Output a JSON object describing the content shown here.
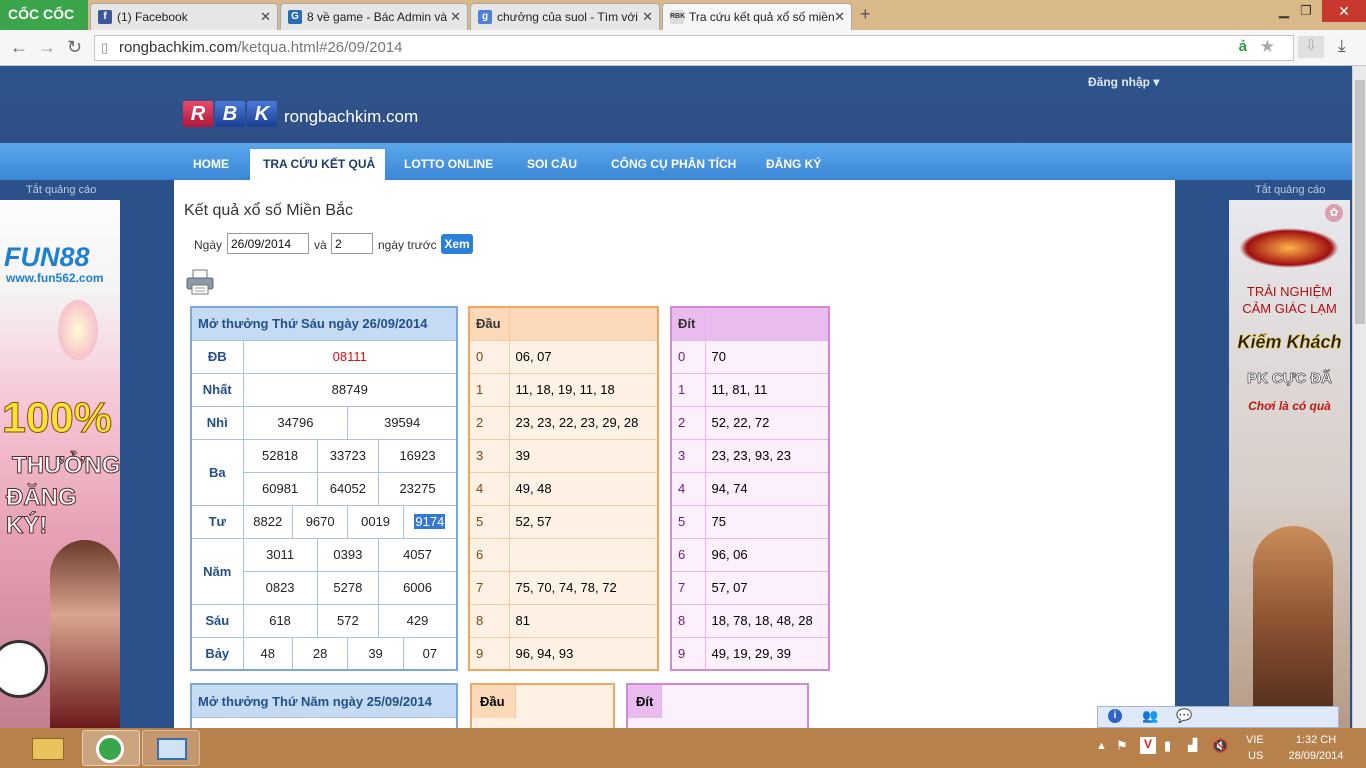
{
  "browser": {
    "app_name": "CỐC CỐC",
    "tabs": [
      {
        "label": "(1) Facebook",
        "icon": "facebook-icon"
      },
      {
        "label": "8 về game - Bác Admin và",
        "icon": "game-site-icon"
      },
      {
        "label": "chưởng của suol - Tìm với",
        "icon": "google-icon"
      },
      {
        "label": "Tra cứu kết quả xổ số miền",
        "icon": "rbk-icon"
      }
    ],
    "url_host": "rongbachkim.com",
    "url_path": "/ketqua.html#26/09/2014"
  },
  "site": {
    "login": "Đăng nhập ▾",
    "logo_letters": [
      "R",
      "B",
      "K"
    ],
    "name": "rongbachkim.com",
    "menu": [
      "HOME",
      "TRA CỨU KẾT QUẢ",
      "LOTTO ONLINE",
      "SOI CẦU",
      "CÔNG CỤ PHÂN TÍCH",
      "ĐĂNG KÝ"
    ],
    "active_menu_index": 1,
    "ad_close_label": "Tắt quảng cáo"
  },
  "left_ad": {
    "brand": "FUN88",
    "url": "www.fun562.com",
    "headline": "100%",
    "line1": "THƯỞNG",
    "line2": "ĐĂNG KÝ!"
  },
  "right_ad": {
    "line1": "TRẢI NGHIỆM",
    "line2": "CẢM GIÁC LẠM",
    "line3": "Kiếm Khách",
    "line4": "PK CỰC ĐÃ",
    "line5": "Chơi là có quà"
  },
  "page": {
    "title": "Kết quả xổ số Miền Bắc",
    "date_label": "Ngày",
    "date_value": "26/09/2014",
    "and_label": "và",
    "days_value": "2",
    "days_before_label": "ngày trước",
    "view_button": "Xem"
  },
  "results": {
    "title": "Mở thưởng Thứ Sáu ngày 26/09/2014",
    "db_label": "ĐB",
    "db": "08111",
    "nhat_label": "Nhất",
    "nhat": "88749",
    "nhi_label": "Nhì",
    "nhi": [
      "34796",
      "39594"
    ],
    "ba_label": "Ba",
    "ba": [
      [
        "52818",
        "33723",
        "16923"
      ],
      [
        "60981",
        "64052",
        "23275"
      ]
    ],
    "tu_label": "Tư",
    "tu": [
      "8822",
      "9670",
      "0019",
      "9174"
    ],
    "nam_label": "Năm",
    "nam": [
      [
        "3011",
        "0393",
        "4057"
      ],
      [
        "0823",
        "5278",
        "6006"
      ]
    ],
    "sau_label": "Sáu",
    "sau": [
      "618",
      "572",
      "429"
    ],
    "bay_label": "Bảy",
    "bay": [
      "48",
      "28",
      "39",
      "07"
    ]
  },
  "dau": {
    "header": "Đầu",
    "rows": [
      {
        "k": "0",
        "v": "06, 07"
      },
      {
        "k": "1",
        "v": "11, 18, 19, 11, 18"
      },
      {
        "k": "2",
        "v": "23, 23, 22, 23, 29, 28"
      },
      {
        "k": "3",
        "v": "39"
      },
      {
        "k": "4",
        "v": "49, 48"
      },
      {
        "k": "5",
        "v": "52, 57"
      },
      {
        "k": "6",
        "v": ""
      },
      {
        "k": "7",
        "v": "75, 70, 74, 78, 72"
      },
      {
        "k": "8",
        "v": "81"
      },
      {
        "k": "9",
        "v": "96, 94, 93"
      }
    ]
  },
  "dit": {
    "header": "Đít",
    "rows": [
      {
        "k": "0",
        "v": "70"
      },
      {
        "k": "1",
        "v": "11, 81, 11"
      },
      {
        "k": "2",
        "v": "52, 22, 72"
      },
      {
        "k": "3",
        "v": "23, 23, 93, 23"
      },
      {
        "k": "4",
        "v": "94, 74"
      },
      {
        "k": "5",
        "v": "75"
      },
      {
        "k": "6",
        "v": "96, 06"
      },
      {
        "k": "7",
        "v": "57, 07"
      },
      {
        "k": "8",
        "v": "18, 78, 18, 48, 28"
      },
      {
        "k": "9",
        "v": "49, 19, 29, 39"
      }
    ]
  },
  "results2": {
    "title": "Mở thưởng Thứ Năm ngày 25/09/2014",
    "dau_header": "Đầu",
    "dit_header": "Đít"
  },
  "taskbar": {
    "lang": "VIE",
    "region": "US",
    "time": "1:32 CH",
    "date": "28/09/2014"
  },
  "colors": {
    "header_bg": "#2e548d",
    "menu_bg": "#4b98e2",
    "results_border": "#7ea6d8",
    "dau_border": "#f4a55e",
    "dit_border": "#cf8ad4",
    "db_color": "#e01010"
  }
}
